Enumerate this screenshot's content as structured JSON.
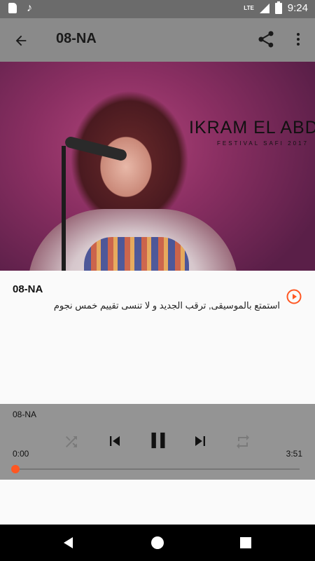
{
  "status_bar": {
    "network": "LTE",
    "time": "9:24",
    "icons": [
      "sd-card-icon",
      "music-note-icon",
      "signal-icon",
      "battery-charging-icon"
    ]
  },
  "app_bar": {
    "title": "08-NA",
    "icons": [
      "back-arrow-icon",
      "share-icon",
      "more-vert-icon"
    ]
  },
  "artwork": {
    "artist": "IKRAM EL ABDIA",
    "subtitle": "FESTIVAL SAFI 2017"
  },
  "track": {
    "title": "08-NA",
    "description": "استمتع بالموسيقى, ترقب الجديد و لا تنسى تقييم خمس نجوم",
    "play_icon": "play-circle-icon",
    "accent": "#ff5722"
  },
  "player": {
    "title": "08-NA",
    "current_time": "0:00",
    "total_time": "3:51",
    "progress": 0.0,
    "controls": [
      "shuffle-icon",
      "skip-previous-icon",
      "pause-icon",
      "skip-next-icon",
      "repeat-icon"
    ]
  },
  "nav_bar": {
    "icons": [
      "nav-back-icon",
      "nav-home-icon",
      "nav-recents-icon"
    ]
  }
}
